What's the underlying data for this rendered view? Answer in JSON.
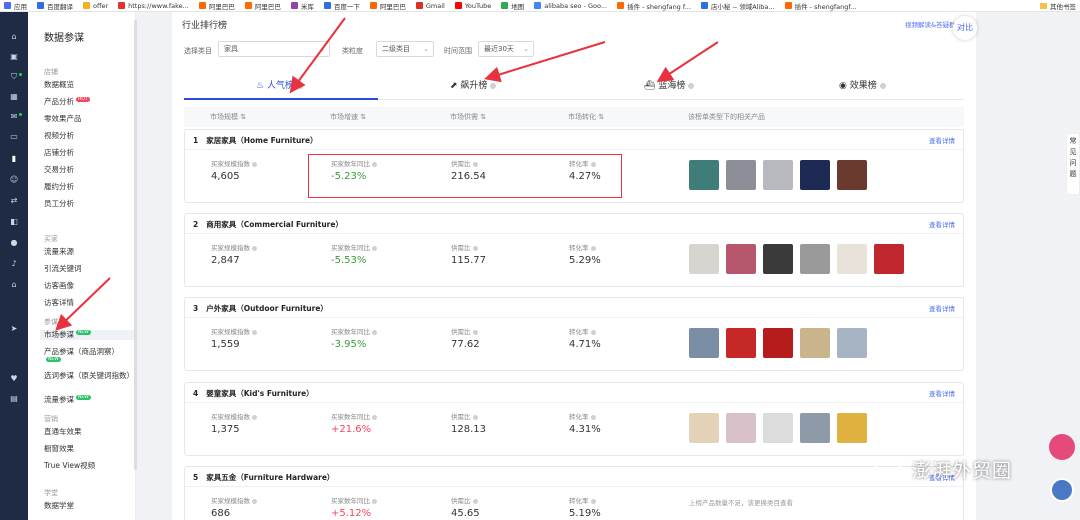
{
  "bookmarks": [
    {
      "label": "应用",
      "color": "#4a6cf7"
    },
    {
      "label": "百度翻译",
      "color": "#2f6fe0"
    },
    {
      "label": "offer",
      "color": "#f5b021"
    },
    {
      "label": "https://www.fake...",
      "color": "#e2322d"
    },
    {
      "label": "阿里巴巴",
      "color": "#ff6a00"
    },
    {
      "label": "阿里巴巴",
      "color": "#ff6a00"
    },
    {
      "label": "米库",
      "color": "#8e44ad"
    },
    {
      "label": "百度一下",
      "color": "#2f6fe0"
    },
    {
      "label": "阿里巴巴",
      "color": "#ff6a00"
    },
    {
      "label": "Gmail",
      "color": "#d93025"
    },
    {
      "label": "YouTube",
      "color": "#ff0000"
    },
    {
      "label": "地图",
      "color": "#34a853"
    },
    {
      "label": "alibaba seo - Goo...",
      "color": "#4285f4"
    },
    {
      "label": "插件 - shengfang f...",
      "color": "#ff6a00"
    },
    {
      "label": "店小秘 -- 领域Aliba...",
      "color": "#2f6fe0"
    },
    {
      "label": "插件 - shengfangf...",
      "color": "#ff6a00"
    }
  ],
  "bookmarks_right": "其他书签",
  "sidebar": {
    "title": "数据参谋",
    "groups": [
      {
        "label": "店铺",
        "items": [
          {
            "label": "数据概览"
          },
          {
            "label": "产品分析",
            "tag": "HOT"
          },
          {
            "label": "零效果产品"
          },
          {
            "label": "视频分析"
          },
          {
            "label": "店铺分析"
          },
          {
            "label": "交易分析"
          },
          {
            "label": "履约分析"
          },
          {
            "label": "员工分析"
          }
        ]
      },
      {
        "label": "买家",
        "items": [
          {
            "label": "流量来源"
          },
          {
            "label": "引流关键词"
          },
          {
            "label": "访客画像"
          },
          {
            "label": "访客详情"
          }
        ]
      },
      {
        "label": "参谋",
        "items": [
          {
            "label": "市场参谋",
            "tag": "NEW"
          },
          {
            "label": "产品参谋（商品洞察）",
            "tag": "NEW"
          },
          {
            "label": "选词参谋（原关键词指数）"
          },
          {
            "label": "流量参谋",
            "tag": "NEW"
          }
        ]
      },
      {
        "label": "营销",
        "items": [
          {
            "label": "直通车效果"
          },
          {
            "label": "橱窗效果"
          },
          {
            "label": "True View视频"
          }
        ]
      },
      {
        "label": "学堂",
        "items": [
          {
            "label": "数据学堂"
          }
        ]
      }
    ]
  },
  "main": {
    "title": "行业排行榜",
    "help_link": "视频解读&答疑群",
    "compare_label": "对比",
    "filters": [
      {
        "label": "选择类目",
        "value": "家具"
      },
      {
        "label": "类粒度",
        "value": "二级类目"
      },
      {
        "label": "时间范围",
        "value": "最近30天"
      }
    ],
    "tabs": [
      "人气榜",
      "飙升榜",
      "蓝海榜",
      "效果榜"
    ],
    "columns": [
      "市场规模",
      "市场增速",
      "市场供需",
      "市场转化",
      "该榜单类型下的相关产品"
    ],
    "metric_labels": [
      "买家规模指数",
      "买家数年同比",
      "供需比",
      "转化率"
    ],
    "detail_link": "查看详情",
    "cards": [
      {
        "rank": "1",
        "name": "家居家具（Home Furniture）",
        "scale": "4,605",
        "yoy": "-5.23%",
        "trend": "down",
        "supply": "216.54",
        "conv": "4.27%",
        "thumbs": [
          "#3f7d7a",
          "#8c8f97",
          "#b7b9bf",
          "#1c2a55",
          "#6b3a2e"
        ]
      },
      {
        "rank": "2",
        "name": "商用家具（Commercial Furniture）",
        "scale": "2,847",
        "yoy": "-5.53%",
        "trend": "down",
        "supply": "115.77",
        "conv": "5.29%",
        "thumbs": [
          "#d8d4cf",
          "#b6576e",
          "#3a3a3a",
          "#9a9a9a",
          "#e8e2d8",
          "#c0262d"
        ]
      },
      {
        "rank": "3",
        "name": "户外家具（Outdoor Furniture）",
        "scale": "1,559",
        "yoy": "-3.95%",
        "trend": "down",
        "supply": "77.62",
        "conv": "4.71%",
        "thumbs": [
          "#7a8fa3",
          "#c62828",
          "#b71c1c",
          "#c9b48c",
          "#a7b4c4"
        ]
      },
      {
        "rank": "4",
        "name": "婴童家具（Kid's Furniture）",
        "scale": "1,375",
        "yoy": "+21.6%",
        "trend": "up",
        "supply": "128.13",
        "conv": "4.31%",
        "thumbs": [
          "#e3d2b8",
          "#d8c0c8",
          "#dcdcdc",
          "#8e9aa8",
          "#e0b040"
        ]
      },
      {
        "rank": "5",
        "name": "家具五金（Furniture Hardware）",
        "scale": "686",
        "yoy": "+5.12%",
        "trend": "up",
        "supply": "45.65",
        "conv": "5.19%",
        "thumbs": [],
        "note": "上榜产品数量不足，该更换类目查看"
      }
    ]
  },
  "float_help": "常见问题",
  "watermark": "澎湃外贸圈"
}
